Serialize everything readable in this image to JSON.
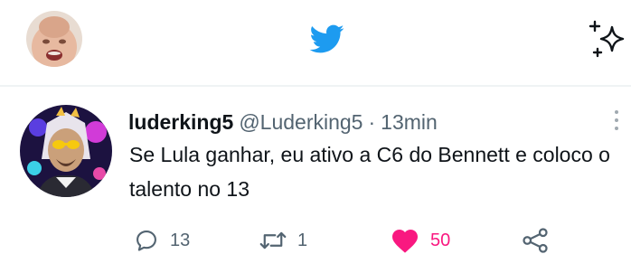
{
  "topbar": {
    "profile_avatar": "user-avatar",
    "logo": "twitter-bird-icon",
    "action_icon": "sparkle-icon"
  },
  "tweet": {
    "display_name": "luderking5",
    "handle": "@Luderking5",
    "separator": "·",
    "time": "13min",
    "text": "Se Lula ganhar, eu ativo a C6 do Bennett e coloco o talento no 13",
    "actions": {
      "replies": "13",
      "retweets": "1",
      "likes": "50",
      "liked": true
    }
  },
  "colors": {
    "brand": "#1d9bf0",
    "like": "#f91880",
    "secondary_text": "#536471",
    "divider": "#eff3f4"
  }
}
